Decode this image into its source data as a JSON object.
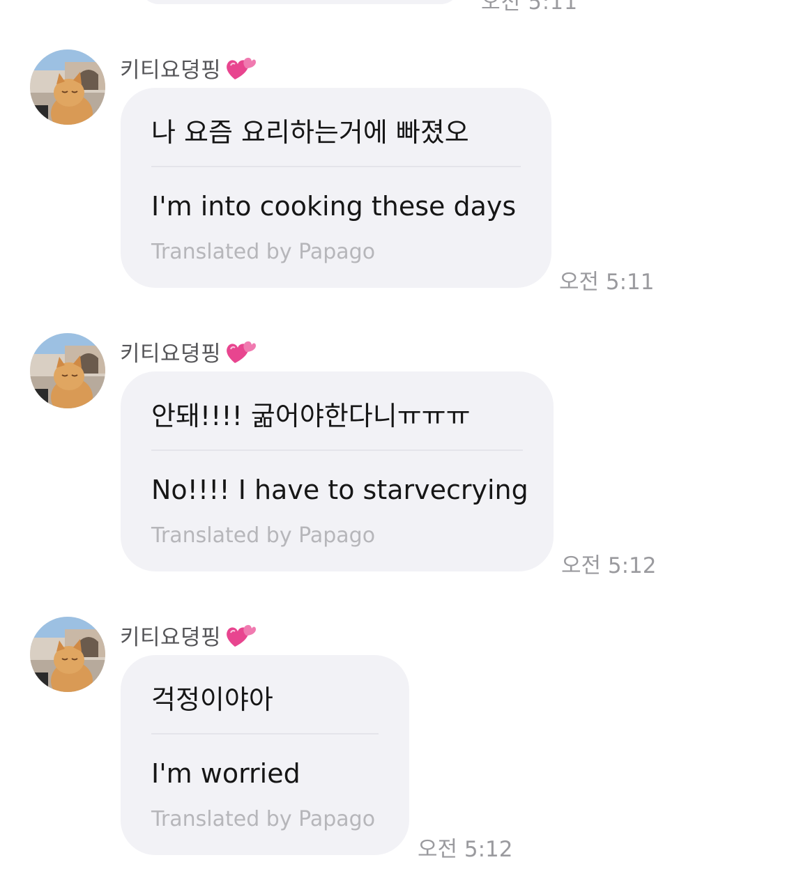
{
  "previous": {
    "time": "오전 5:11"
  },
  "messages": [
    {
      "sender": "키티요뎡핑",
      "original": "나 요즘 요리하는거에 빠졌오",
      "translation": "I'm into cooking these days",
      "credit": "Translated by Papago",
      "time": "오전 5:11"
    },
    {
      "sender": "키티요뎡핑",
      "original": "안돼!!!! 굶어야한다니ㅠㅠㅠ",
      "translation": "No!!!! I have to starvecrying",
      "credit": "Translated by Papago",
      "time": "오전 5:12"
    },
    {
      "sender": "키티요뎡핑",
      "original": "걱정이야아",
      "translation": "I'm worried",
      "credit": "Translated by Papago",
      "time": "오전 5:12"
    }
  ],
  "icons": {
    "avatar": "cat-avatar-icon",
    "heart": "two-hearts-icon"
  },
  "colors": {
    "bubble": "#f2f2f6",
    "heart": "#e8458f"
  }
}
